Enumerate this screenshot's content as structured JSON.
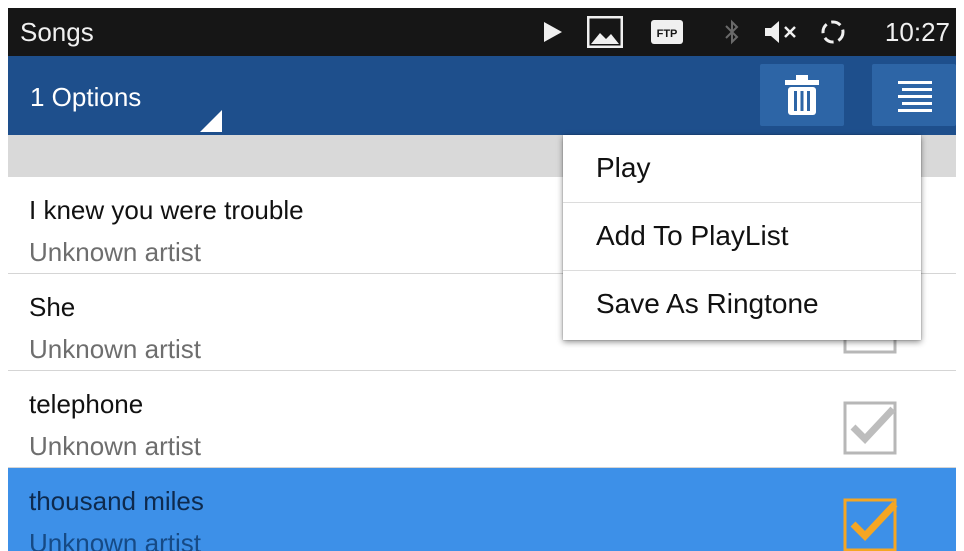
{
  "status_bar": {
    "title": "Songs",
    "time": "10:27",
    "icons": [
      "play-icon",
      "image-icon",
      "ftp-icon",
      "bluetooth-icon",
      "volume-muted-icon",
      "sync-icon"
    ],
    "ftp_label": "FTP"
  },
  "action_bar": {
    "options_label": "1 Options",
    "buttons": [
      "delete-icon",
      "menu-icon"
    ]
  },
  "colors": {
    "status_bar_bg": "#161616",
    "action_bar_bg": "#1e4f8c",
    "button_bg": "#2d65a6",
    "selected_row_bg": "#3d90e8",
    "check_selected": "#f5a623",
    "check_unselected": "#b7b7b7"
  },
  "songs": [
    {
      "title": "I knew you were trouble",
      "artist": "Unknown artist",
      "checked": false
    },
    {
      "title": "She",
      "artist": "Unknown artist",
      "checked": false
    },
    {
      "title": "telephone",
      "artist": "Unknown artist",
      "checked": false
    },
    {
      "title": "thousand miles",
      "artist": "Unknown artist",
      "checked": true
    }
  ],
  "menu": {
    "items": [
      {
        "label": "Play"
      },
      {
        "label": "Add To PlayList"
      },
      {
        "label": "Save As Ringtone"
      }
    ]
  }
}
